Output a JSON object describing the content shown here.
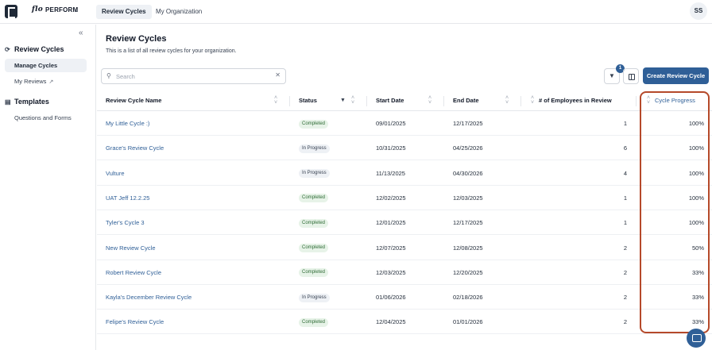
{
  "topbar": {
    "brand": "PERFORM",
    "brand_script": "flo",
    "tabs": [
      "Review Cycles",
      "My Organization"
    ],
    "avatar": "SS"
  },
  "sidebar": {
    "review_cycles_heading": "Review Cycles",
    "manage_cycles": "Manage Cycles",
    "my_reviews": "My Reviews",
    "templates_heading": "Templates",
    "questions_forms": "Questions and Forms"
  },
  "main": {
    "title": "Review Cycles",
    "subtitle": "This is a list of all review cycles for your organization.",
    "search_placeholder": "Search",
    "filter_count": "1",
    "create_button": "Create Review Cycle"
  },
  "table": {
    "columns": [
      "Review Cycle Name",
      "Status",
      "Start Date",
      "End Date",
      "# of Employees in Review",
      "Cycle Progress"
    ],
    "rows": [
      {
        "name": "My Little Cycle :)",
        "status": "Completed",
        "start": "09/01/2025",
        "end": "12/17/2025",
        "employees": "1",
        "progress": "100%"
      },
      {
        "name": "Grace's Review Cycle",
        "status": "In Progress",
        "start": "10/31/2025",
        "end": "04/25/2026",
        "employees": "6",
        "progress": "100%"
      },
      {
        "name": "Vulture",
        "status": "In Progress",
        "start": "11/13/2025",
        "end": "04/30/2026",
        "employees": "4",
        "progress": "100%"
      },
      {
        "name": "UAT Jeff 12.2.25",
        "status": "Completed",
        "start": "12/02/2025",
        "end": "12/03/2025",
        "employees": "1",
        "progress": "100%"
      },
      {
        "name": "Tyler's Cycle 3",
        "status": "Completed",
        "start": "12/01/2025",
        "end": "12/17/2025",
        "employees": "1",
        "progress": "100%"
      },
      {
        "name": "New Review Cycle",
        "status": "Completed",
        "start": "12/07/2025",
        "end": "12/08/2025",
        "employees": "2",
        "progress": "50%"
      },
      {
        "name": "Robert Review Cycle",
        "status": "Completed",
        "start": "12/03/2025",
        "end": "12/20/2025",
        "employees": "2",
        "progress": "33%"
      },
      {
        "name": "Kayla's December Review Cycle",
        "status": "In Progress",
        "start": "01/06/2026",
        "end": "02/18/2026",
        "employees": "2",
        "progress": "33%"
      },
      {
        "name": "Felipe's Review Cycle",
        "status": "Completed",
        "start": "12/04/2025",
        "end": "01/01/2026",
        "employees": "2",
        "progress": "33%"
      }
    ]
  },
  "colors": {
    "accent": "#2f5f97",
    "highlight": "#b5492a",
    "completed_bg": "#e7f3e8"
  }
}
